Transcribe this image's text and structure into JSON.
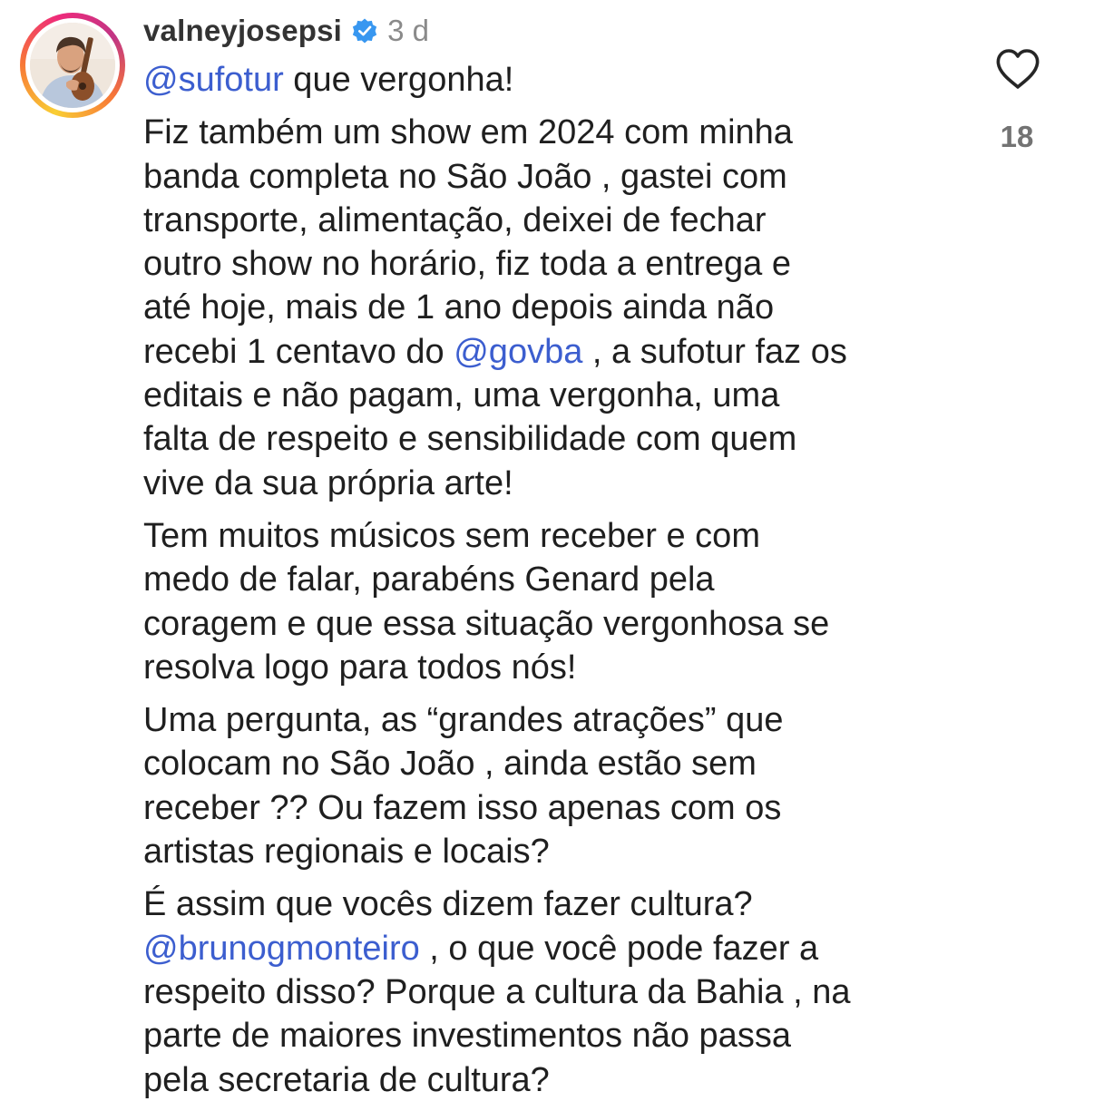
{
  "comment": {
    "username": "valneyjosepsi",
    "verified": true,
    "time": "3 d",
    "likes": "18",
    "icons": {
      "avatar": "avatar-photo",
      "verified": "verified-badge-icon",
      "like": "heart-icon"
    },
    "colors": {
      "mention": "#3c5ecf",
      "verified": "#3897f0",
      "text": "#1f1f1f",
      "meta": "#8a8a8a"
    },
    "p1": {
      "mention": "@sufotur",
      "text": " que vergonha!"
    },
    "p2": {
      "before": "Fiz também um show em 2024 com minha\nbanda completa no São João , gastei com\ntransporte, alimentação, deixei de fechar\noutro show no horário, fiz toda a entrega e\naté hoje, mais de 1 ano depois ainda não\nrecebi 1 centavo do ",
      "mention": "@govba",
      "after": " , a sufotur faz os\neditais e não pagam, uma vergonha, uma\nfalta de respeito e sensibilidade com quem\nvive da sua própria arte!"
    },
    "p3": "Tem muitos músicos sem receber e com\nmedo de falar, parabéns Genard pela\ncoragem e que essa situação vergonhosa se\nresolva logo para todos nós!",
    "p4": "Uma pergunta, as “grandes atrações” que\ncolocam no São João , ainda estão sem\nreceber ?? Ou fazem isso apenas com os\nartistas regionais e locais?",
    "p5": {
      "before": "É assim que vocês dizem fazer cultura?\n",
      "mention": "@brunogmonteiro",
      "after": " , o que você pode fazer a\nrespeito disso? Porque a cultura da Bahia , na\nparte de maiores investimentos não passa\npela secretaria de cultura?"
    }
  }
}
